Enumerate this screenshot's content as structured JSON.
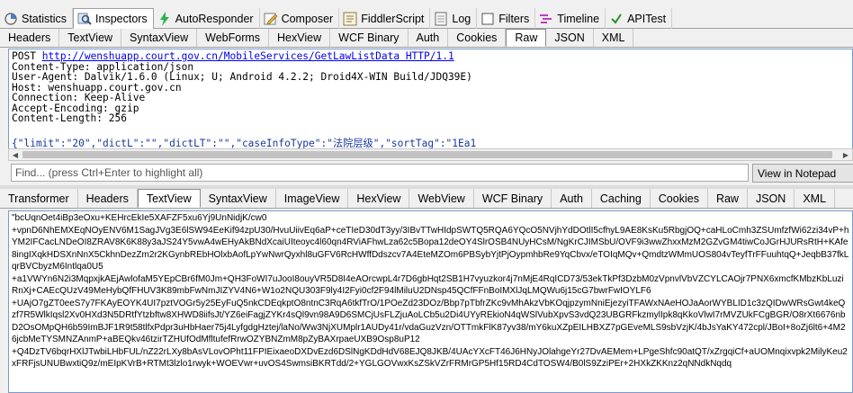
{
  "main_tabs": [
    {
      "label": "Statistics",
      "icon": "statistics-icon"
    },
    {
      "label": "Inspectors",
      "icon": "inspectors-icon",
      "active": true
    },
    {
      "label": "AutoResponder",
      "icon": "lightning-icon"
    },
    {
      "label": "Composer",
      "icon": "composer-icon"
    },
    {
      "label": "FiddlerScript",
      "icon": "fiddlerscript-icon"
    },
    {
      "label": "Log",
      "icon": "log-icon"
    },
    {
      "label": "Filters",
      "icon": "filters-icon"
    },
    {
      "label": "Timeline",
      "icon": "timeline-icon"
    },
    {
      "label": "APITest",
      "icon": "apitest-icon"
    }
  ],
  "request_tabs": [
    "Headers",
    "TextView",
    "SyntaxView",
    "WebForms",
    "HexView",
    "WCF Binary",
    "Auth",
    "Cookies",
    "Raw",
    "JSON",
    "XML"
  ],
  "request_active": "Raw",
  "request": {
    "method": "POST ",
    "url": "http://wenshuapp.court.gov.cn/MobileServices/GetLawListData HTTP/1.1",
    "lines": [
      "Content-Type: application/json",
      "User-Agent: Dalvik/1.6.0 (Linux; U; Android 4.2.2; Droid4X-WIN Build/JDQ39E)",
      "Host: wenshuapp.court.gov.cn",
      "Connection: Keep-Alive",
      "Accept-Encoding: gzip",
      "Content-Length: 256"
    ],
    "body_partial": "{\"limit\":\"20\",\"dictL\":\"\",\"dictLT\":\"\",\"caseInfoType\":\"法院层级\",\"sortTag\":\"1Ea1"
  },
  "find_placeholder": "Find... (press Ctrl+Enter to highlight all)",
  "view_button": "View in Notepad",
  "response_tabs": [
    "Transformer",
    "Headers",
    "TextView",
    "SyntaxView",
    "ImageView",
    "HexView",
    "WebView",
    "WCF Binary",
    "Auth",
    "Caching",
    "Cookies",
    "Raw",
    "JSON",
    "XML"
  ],
  "response_active": "TextView",
  "response_text": "\"bcUqnOet4iBp3eOxu+KEHrcEkIe5XAFZF5xu6Yj9UnNidjK/cw0\n+vpnD6NhEMXEqNOyENV6M1SagJVg3E6lSW94EeKif94zpU30/HvuUiivEq6aP+ceTIeD30dT3yy/3IBvTTwHIdpSWTQ5RQA6YQcO5NVjhYdDOtlI5cfhyL9AE8KsKu5RbgjOQ+caHLoCmh3ZSUmfzfWi62zi34vP+hYM2IFCacLNDeOI8ZRAV8K6K88y3aJS24Y5vwA4wEHyAkBNdXcaiUIteoyc4l60qn4RViAFhwLza62c5Bopa12deOY4SlrOSB4NUyHCsM/NgKrCJIMSbU/OVF9i3wwZhxxMzM2GZvGM4tiwCoJGrHJURsRtH+KAfe8ingIXqkHDSXnNnX5CkhnDezZm2r2KGynbREbHOlxbAofLpYwNwrQyxhl8uGFV6RcHWffDdszcv7A4EteMZOm6PBSybYjtPjOypmhbRe9YqCbvx/eTOIqMQv+QmdtzWMmUOS804vTeyfTrFFuuhtqQ+JeqbB37fkLqrBVCbyzM6Intlqa0U5\n+a1VWYn6N2i3MqpxjkAEjAwlofaM5YEpCBr6fM0Jm+QH3FoWI7uJooI8ouyVR5D8I4eAOrcwpL4r7D6gbHqt2SB1H7vyuzkor4j7nMjE4RqICD73/53ekTkPf3DzbM0zVpnvlVbVZCYLCAOjr7PNX6xmcfKMbzKbLuziRnXj+CAEcQUzV49MeHybQfFHUV3K89mbFwNmJIZYV4N6+W1o2NQU303F9ly4I2Fyi0cf2F94lMiluU2DNsp45QCfFFnBoIMXlJqLMQWu6j15cG7bwrFwIOYLF6\n+UAjO7gZT0eeS7y7FKAyEOYK4UI7pztVOGr5y25EyFuQ5nkCDEqkptO8ntnC3RqA6tkfTrO/1POeZd23DOz/Bbp7pTbfrZKc9vMhAkzVbKOqjpzymNniEjezyiTFAWxNAeHOJaAorWYBLID1c3zQIDwWRsGwt4keQzf7R5WlkIqsl2Xv0HXd3N5DRtfYtzbftw8XHWD8iifsJt/YZ6eiFagjZYKr4sQl9vn98A9D6SMCjUsFLZjuAoLCb5u2Di4UYyREkioN4qWSlVubXpvS3vdQ23UBGRFkzmylIpk8qKkoVlwI7rMVZUkFCgBGR/O8rXt6676nbD2OsOMpQH6b59ImBJF1R9t58tlfxPdpr3uHbHaer75j4LyfgdgHztej/laNo/Ww3NjXUMplr1AUDy41r/vdaGuzVzn/OTTmkFlK87yv38/mY6kuXZpEILHBXZ7pGEveMLS9sbVzjK/4bJsYaKY472cpl/JBoI+8oZj6lt6+4M26jcbMeTYSMNZAnmP+aBEQkv46tzirTZHUfOdMfltufefRrwOZYBNZmM8pZyBAXrpaeUXB9Osp8uP12\n+Q4DzTV6bqrHXlJTwbiLHbFUL/nZ22rLXy8bAsVLovOPht11FPIEixaeoDXDvEzd6DSlNgKDdHdV68EJQ8JKB/4UAcYXcFT46J6HNyJOlahgeYr27DvAEMem+LPgeShfc90atQT/xZrgqiCf+aUOMnqixvpk2MilyKeu2xFRFjsUNUBwxtiQ9z/mEIpKVrB+RTMt3lzlo1rwyk+WOEVwr+uvOS4SwmsiBKRTdd/2+YGLGOVwxKsZSkVZrFRMrGP5Hf15RD4CdTOSW4/B0lS9ZziPEr+2HXkZKKnz2qNNdkNqdq"
}
